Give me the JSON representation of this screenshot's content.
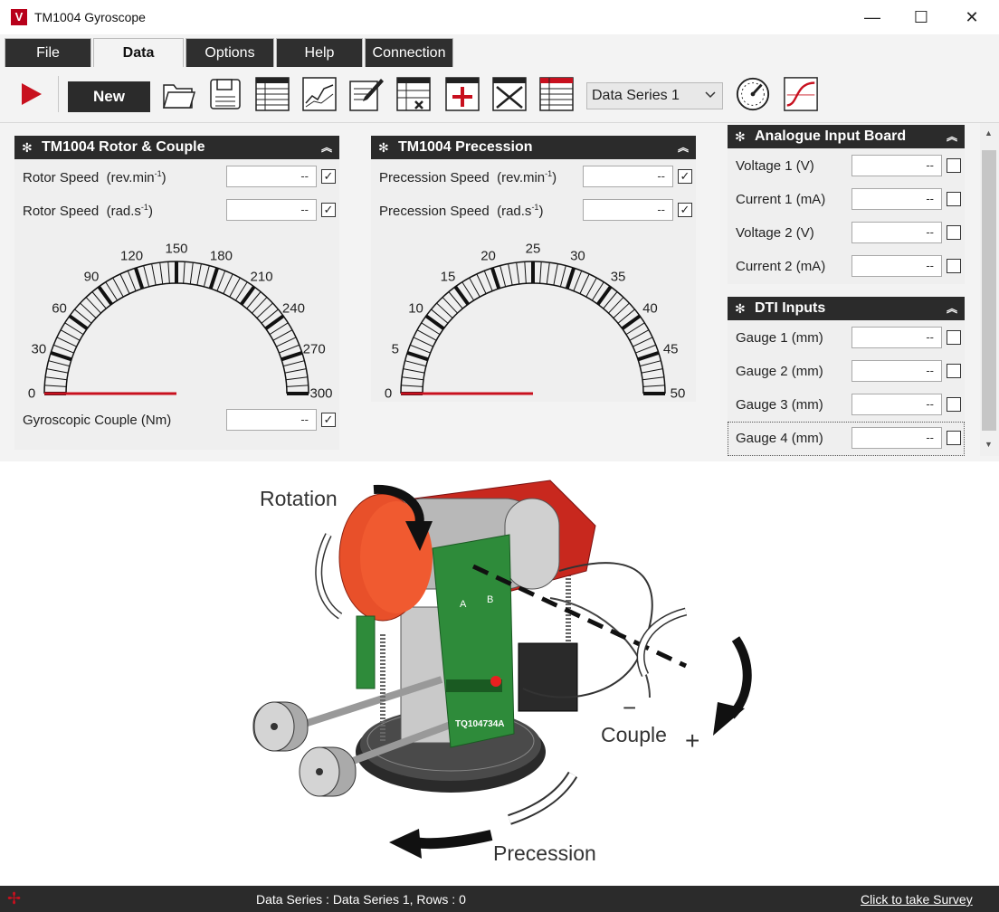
{
  "window": {
    "title": "TM1004 Gyroscope",
    "logo_letter": "V",
    "minimize": "—",
    "maximize": "☐",
    "close": "✕"
  },
  "menu": {
    "tabs": [
      {
        "label": "File"
      },
      {
        "label": "Data"
      },
      {
        "label": "Options"
      },
      {
        "label": "Help"
      },
      {
        "label": "Connection"
      }
    ],
    "active_tab": "Data"
  },
  "toolbar": {
    "new_label": "New",
    "series_selected": "Data Series 1",
    "icons": [
      "play-icon",
      "open-folder-icon",
      "save-icon",
      "table-icon",
      "chart-icon",
      "edit-icon",
      "delete-rows-icon",
      "add-series-icon",
      "delete-series-icon",
      "table-view-icon",
      "meter-icon",
      "curve-icon"
    ]
  },
  "rotor_panel": {
    "title": "TM1004 Rotor & Couple",
    "rows": [
      {
        "label": "Rotor Speed",
        "unit_pre": "(rev.min",
        "unit_sup": "-1",
        "unit_post": ")",
        "value": "--",
        "checked": true
      },
      {
        "label": "Rotor Speed",
        "unit_pre": "(rad.s",
        "unit_sup": "-1",
        "unit_post": ")",
        "value": "--",
        "checked": true
      }
    ],
    "gauge_ticks": [
      "0",
      "30",
      "60",
      "90",
      "120",
      "150",
      "180",
      "210",
      "240",
      "270",
      "300"
    ],
    "gauge_value": 0,
    "couple": {
      "label": "Gyroscopic Couple",
      "unit": "(Nm)",
      "value": "--",
      "checked": true
    }
  },
  "precession_panel": {
    "title": "TM1004 Precession",
    "rows": [
      {
        "label": "Precession Speed",
        "unit_pre": "(rev.min",
        "unit_sup": "-1",
        "unit_post": ")",
        "value": "--",
        "checked": true
      },
      {
        "label": "Precession Speed",
        "unit_pre": "(rad.s",
        "unit_sup": "-1",
        "unit_post": ")",
        "value": "--",
        "checked": true
      }
    ],
    "gauge_ticks": [
      "0",
      "5",
      "10",
      "15",
      "20",
      "25",
      "30",
      "35",
      "40",
      "45",
      "50"
    ],
    "gauge_value": 0
  },
  "analogue_panel": {
    "title": "Analogue Input Board",
    "rows": [
      {
        "label": "Voltage 1 (V)",
        "value": "--",
        "checked": false
      },
      {
        "label": "Current 1 (mA)",
        "value": "--",
        "checked": false
      },
      {
        "label": "Voltage 2 (V)",
        "value": "--",
        "checked": false
      },
      {
        "label": "Current 2 (mA)",
        "value": "--",
        "checked": false
      }
    ]
  },
  "dti_panel": {
    "title": "DTI Inputs",
    "rows": [
      {
        "label": "Gauge 1 (mm)",
        "value": "--",
        "checked": false
      },
      {
        "label": "Gauge 2 (mm)",
        "value": "--",
        "checked": false
      },
      {
        "label": "Gauge 3 (mm)",
        "value": "--",
        "checked": false
      },
      {
        "label": "Gauge 4 (mm)",
        "value": "--",
        "checked": false
      }
    ]
  },
  "diagram": {
    "rotation": "Rotation",
    "couple": "Couple",
    "precession": "Precession",
    "minus": "−",
    "plus": "+",
    "board_text": "TQ104734A",
    "board_a": "A",
    "board_b": "B"
  },
  "status": {
    "text": "Data Series : Data Series 1,  Rows : 0",
    "survey": "Click to take Survey"
  },
  "colors": {
    "accent_red": "#c8101e",
    "dark": "#2b2b2b",
    "panel_bg": "#efefef"
  }
}
